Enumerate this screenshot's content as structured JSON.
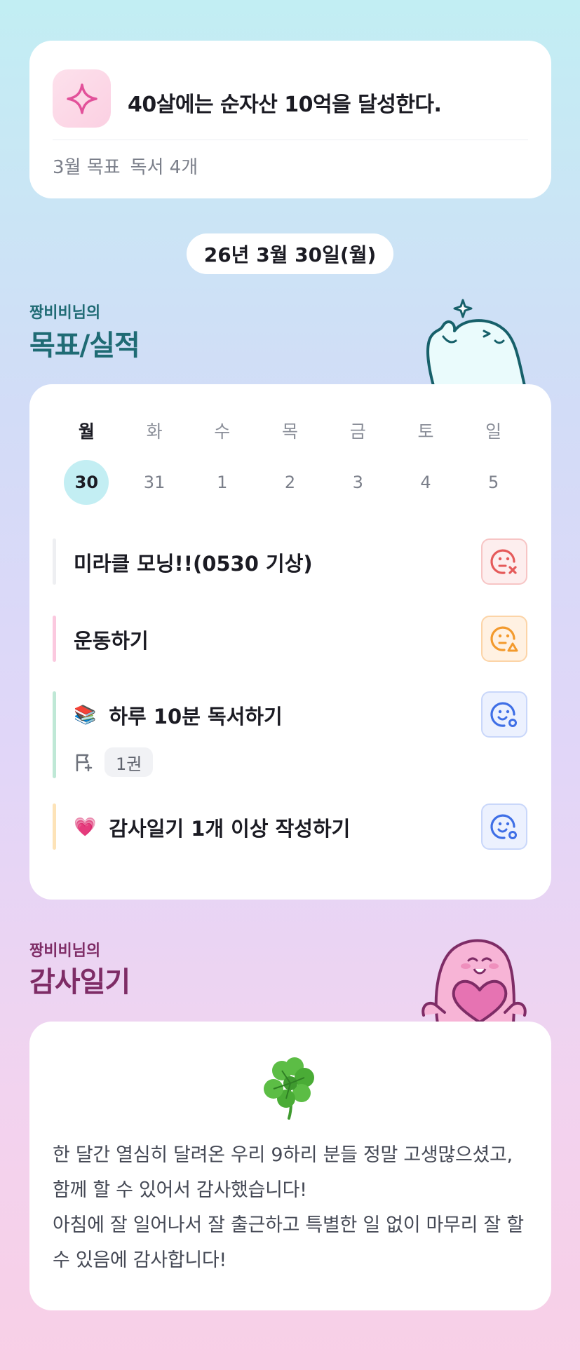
{
  "goal": {
    "title": "40살에는 순자산 10억을 달성한다.",
    "month_label": "3월 목표",
    "month_goal": "독서 4개"
  },
  "date": "26년 3월 30일(월)",
  "goals_section": {
    "subtitle": "짱비비님의",
    "title": "목표/실적"
  },
  "week": {
    "days": [
      "월",
      "화",
      "수",
      "목",
      "금",
      "토",
      "일"
    ],
    "dates": [
      "30",
      "31",
      "1",
      "2",
      "3",
      "4",
      "5"
    ],
    "active_index": 0
  },
  "tasks": [
    {
      "label": "미라클 모닝!!(0530 기상)",
      "emoji": "",
      "bar_color": "#eeeff2",
      "status": "fail",
      "status_color": "#e55a5a"
    },
    {
      "label": "운동하기",
      "emoji": "",
      "bar_color": "#fbc9df",
      "status": "partial",
      "status_color": "#f39a2d"
    },
    {
      "label": "하루 10분 독서하기",
      "emoji": "📚",
      "bar_color": "#bfe8d6",
      "status": "success",
      "status_color": "#3f6fe6",
      "sub_value": "1권"
    },
    {
      "label": "감사일기 1개 이상 작성하기",
      "emoji": "💗",
      "bar_color": "#fde3b8",
      "status": "success",
      "status_color": "#3f6fe6"
    }
  ],
  "gratitude_section": {
    "subtitle": "짱비비님의",
    "title": "감사일기"
  },
  "gratitude": {
    "text": "한 달간 열심히 달려온 우리 9하리 분들 정말 고생많으셨고, 함께 할 수 있어서 감사했습니다!\n아침에 잘 일어나서 잘 출근하고 특별한 일 없이 마무리 잘 할 수 있음에 감사합니다!"
  },
  "icons": {
    "goal": "sparkle-icon",
    "fail": "frown-x-icon",
    "partial": "neutral-triangle-icon",
    "success": "smile-circle-icon",
    "book_count": "flag-icon",
    "gratitude": "clover-icon"
  }
}
